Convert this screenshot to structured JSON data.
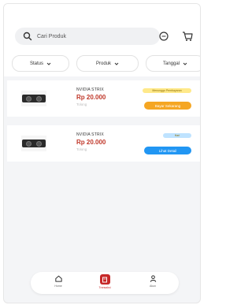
{
  "search": {
    "placeholder": "Cari Produk"
  },
  "header": {
    "chat_icon": "chat-bubble-icon",
    "cart_icon": "cart-icon"
  },
  "filters": [
    {
      "label": "Status"
    },
    {
      "label": "Produk"
    },
    {
      "label": "Tanggal"
    }
  ],
  "orders": [
    {
      "product": "NVIDIA STRIX",
      "price": "Rp 20.000",
      "location": "Tolong",
      "status_label": "Menunggu Pembayaran",
      "status_color": "#ffe98a",
      "action_label": "Bayar Sekarang",
      "action_color": "#f5a623"
    },
    {
      "product": "NVIDIA STRIX",
      "price": "Rp 20.000",
      "location": "Tolong",
      "status_label": "Hari",
      "status_color": "#bfe3ff",
      "action_label": "Lihat Detail",
      "action_color": "#2196f3"
    }
  ],
  "bottom_nav": [
    {
      "label": "Home",
      "icon": "home-icon"
    },
    {
      "label": "Transaksi",
      "icon": "transaction-icon",
      "active": true
    },
    {
      "label": "Akun",
      "icon": "account-icon"
    }
  ],
  "colors": {
    "accent": "#c62828",
    "price": "#c0392b"
  }
}
